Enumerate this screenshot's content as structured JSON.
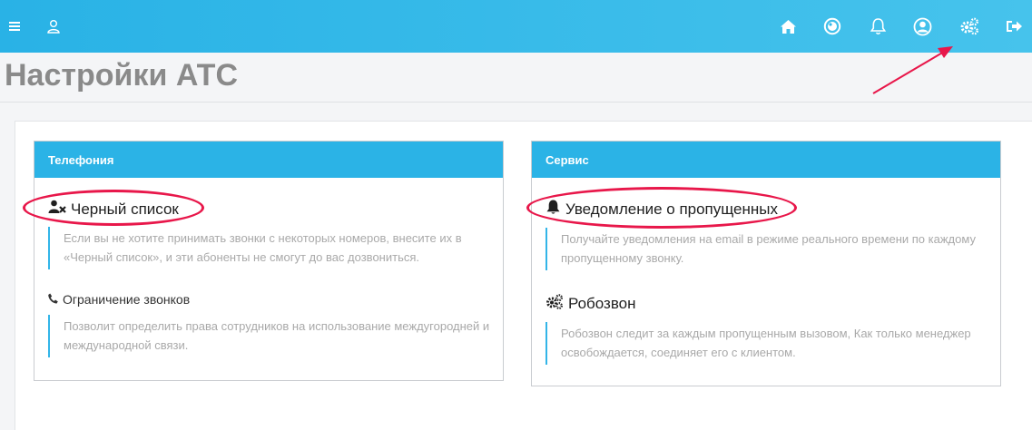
{
  "page": {
    "title": "Настройки АТС"
  },
  "topbar": {
    "left_icons": [
      "menu-icon",
      "user-icon"
    ],
    "right_icons": [
      "home-icon",
      "record-icon",
      "bell-icon",
      "account-icon",
      "gears-icon",
      "logout-icon"
    ]
  },
  "panels": {
    "telephony": {
      "title": "Телефония",
      "items": [
        {
          "icon": "user-block-icon",
          "title": "Черный список",
          "description": "Если вы не хотите принимать звонки с некоторых номеров, внесите их в «Черный список», и эти абоненты не смогут до вас дозвониться."
        },
        {
          "icon": "phone-icon",
          "title": "Ограничение звонков",
          "description": "Позволит определить права сотрудников на использование междугородней и международной связи."
        }
      ]
    },
    "service": {
      "title": "Сервис",
      "items": [
        {
          "icon": "bell-icon",
          "title": "Уведомление о пропущенных",
          "description": "Получайте уведомления на email в режиме реального времени по каждому пропущенному звонку."
        },
        {
          "icon": "gears-icon",
          "title": "Робозвон",
          "description": "Робозвон следит за каждым пропущенным вызовом, Как только менеджер освобождается, соединяет его с клиентом."
        }
      ]
    }
  },
  "colors": {
    "topbar": "#29b2e6",
    "panel_header": "#2bb3e6",
    "highlight": "#e8174a",
    "accent_border": "#33b5e8"
  }
}
